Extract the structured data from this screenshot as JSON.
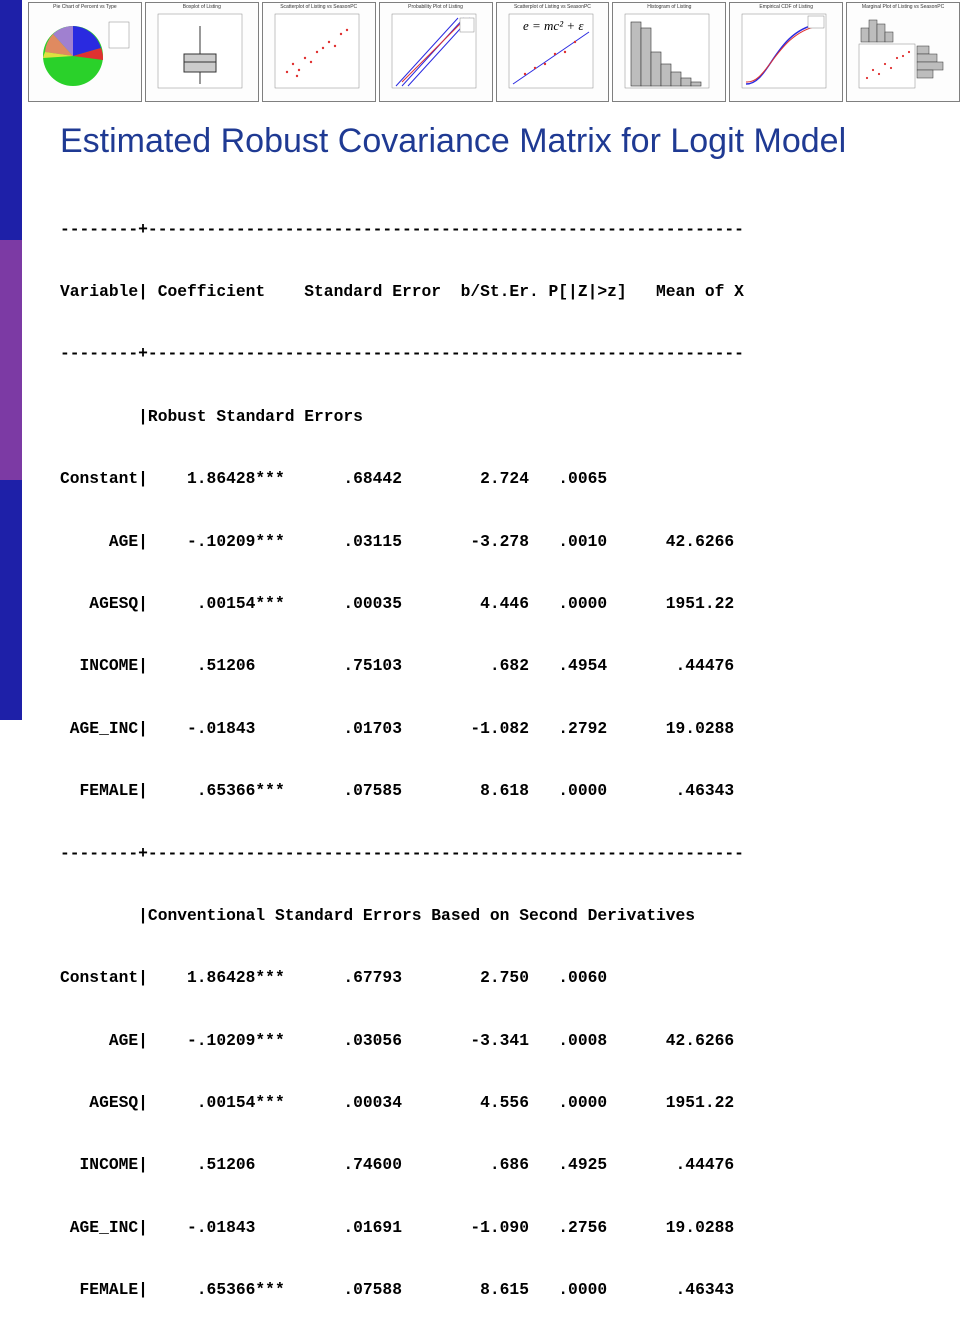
{
  "slide": {
    "title": "Estimated Robust Covariance Matrix for Logit Model",
    "accent_colors": {
      "left_bar_top": "#1e20a8",
      "left_bar_middle": "#7c3aa4",
      "left_bar_bottom": "#1e20a8",
      "title": "#1f3a93"
    }
  },
  "thumbnails": [
    {
      "caption": "Pie Chart of Percent vs Type",
      "icon": "pie-chart-icon"
    },
    {
      "caption": "Boxplot of Listing",
      "icon": "boxplot-icon"
    },
    {
      "caption": "Scatterplot of Listing vs SeasonPC",
      "icon": "scatterplot-icon"
    },
    {
      "caption": "Probability Plot of Listing",
      "icon": "probability-plot-icon"
    },
    {
      "caption": "Scatterplot of Listing vs SeasonPC",
      "icon": "scatterplot-fit-icon",
      "formula": "e = mc² + ε"
    },
    {
      "caption": "Histogram of Listing",
      "icon": "histogram-icon"
    },
    {
      "caption": "Empirical CDF of Listing",
      "icon": "ecdf-icon"
    },
    {
      "caption": "Marginal Plot of Listing vs SeasonPC",
      "icon": "marginal-plot-icon"
    }
  ],
  "output": {
    "rule": "--------+-------------------------------------------------------------",
    "header": "Variable| Coefficient    Standard Error  b/St.Er. P[|Z|>z]   Mean of X",
    "sections": [
      {
        "heading": "        |Robust Standard Errors",
        "rows": [
          "Constant|    1.86428***      .68442        2.724   .0065",
          "     AGE|    -.10209***      .03115       -3.278   .0010      42.6266",
          "   AGESQ|     .00154***      .00035        4.446   .0000      1951.22",
          "  INCOME|     .51206         .75103         .682   .4954       .44476",
          " AGE_INC|    -.01843         .01703       -1.082   .2792      19.0288",
          "  FEMALE|     .65366***      .07585        8.618   .0000       .46343"
        ]
      },
      {
        "heading": "        |Conventional Standard Errors Based on Second Derivatives",
        "rows": [
          "Constant|    1.86428***      .67793        2.750   .0060",
          "     AGE|    -.10209***      .03056       -3.341   .0008      42.6266",
          "   AGESQ|     .00154***      .00034        4.556   .0000      1951.22",
          "  INCOME|     .51206         .74600         .686   .4925       .44476",
          " AGE_INC|    -.01843         .01691       -1.090   .2756      19.0288",
          "  FEMALE|     .65366***      .07588        8.615   .0000       .46343"
        ]
      }
    ]
  }
}
